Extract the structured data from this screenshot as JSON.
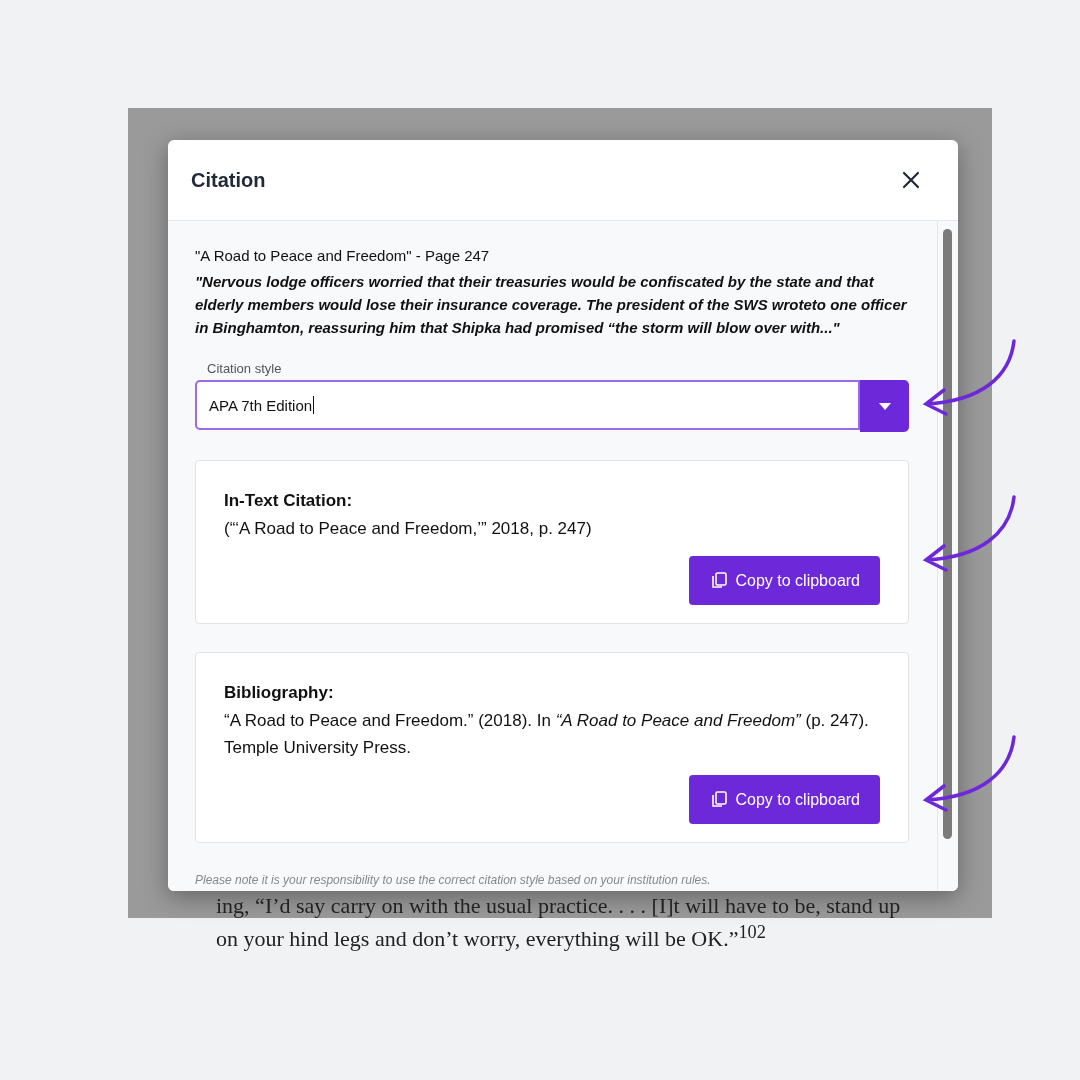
{
  "dialog": {
    "title": "Citation"
  },
  "source": {
    "heading": "\"A Road to Peace and Freedom\" - Page 247",
    "quote": "\"Nervous lodge officers worried that their treasuries would be confiscated by the state and that elderly members would lose their insurance coverage. The president of the SWS wroteto one officer in Binghamton, reassuring him that Shipka had promised “the storm will blow over with...\""
  },
  "citation_style": {
    "label": "Citation style",
    "value": "APA 7th Edition"
  },
  "sections": [
    {
      "heading": "In-Text Citation:",
      "text": "(“‘A Road to Peace and Freedom,’” 2018, p. 247)",
      "button": "Copy to clipboard"
    },
    {
      "heading": "Bibliography:",
      "text": "“A Road to Peace and Freedom.” (2018). In *“A Road to Peace and Freedom”* (p. 247). Temple University Press.",
      "button": "Copy to clipboard"
    }
  ],
  "note": "Please note it is your responsibility to use the correct citation style based on your institution rules.",
  "background_text": [
    "ing, “I’d say carry on with the usual practice. . . . [I]t will have to be, stand up",
    "on your hind legs and don’t worry, everything will be OK.”$^{102}$"
  ]
}
